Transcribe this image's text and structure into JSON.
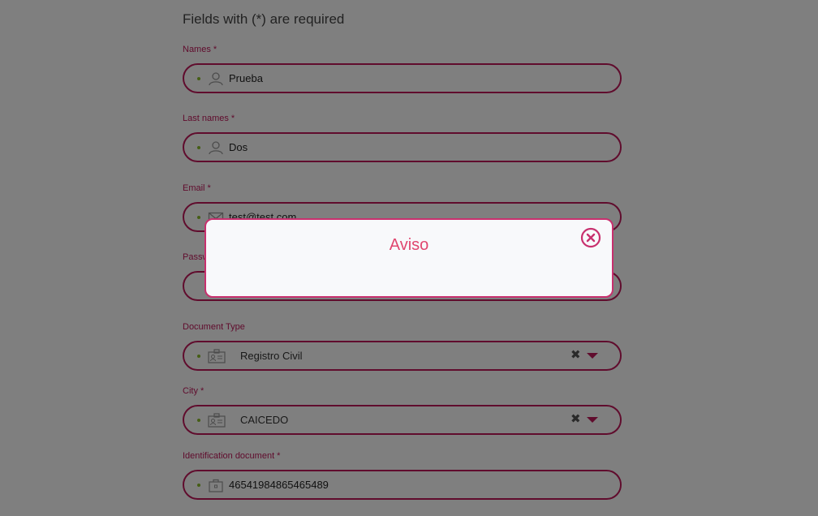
{
  "form": {
    "header": "Fields with (*) are required",
    "names": {
      "label": "Names *",
      "value": "Prueba",
      "icon": "user-icon"
    },
    "last_names": {
      "label": "Last names *",
      "value": "Dos",
      "icon": "user-icon"
    },
    "email": {
      "label": "Email *",
      "value": "test@test.com",
      "icon": "envelope-icon"
    },
    "password": {
      "label": "Passw"
    },
    "document_type": {
      "label": "Document Type",
      "value": "Registro Civil",
      "icon": "id-card-icon"
    },
    "city": {
      "label": "City *",
      "value": "CAICEDO",
      "icon": "id-card-icon"
    },
    "identification": {
      "label": "Identification document *",
      "value": "46541984865465489",
      "icon": "briefcase-icon"
    },
    "clear_symbol": "✖"
  },
  "modal": {
    "title": "Aviso",
    "close_icon": "close-circle-icon"
  },
  "colors": {
    "accent": "#c0185a",
    "modal_title": "#e0476f",
    "dot": "#8bbd2b"
  }
}
